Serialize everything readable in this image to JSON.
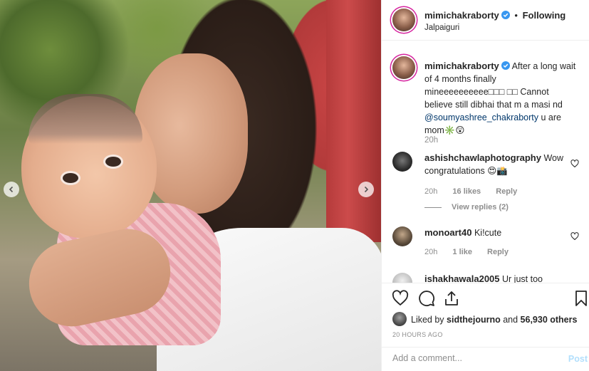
{
  "photo": {
    "alt_subject": "woman kissing baby"
  },
  "header": {
    "username": "mimichakraborty",
    "separator": "•",
    "follow_label": "Following",
    "location": "Jalpaiguri"
  },
  "caption": {
    "username": "mimichakraborty",
    "text_before": "After a long wait of 4 months finally mineeeeeeeeee□□□ □□ Cannot believe still dibhai that m a masi nd ",
    "mention": "@soumyashree_chakraborty",
    "text_after": " u are mom✳️😲",
    "time": "20h"
  },
  "comments": [
    {
      "username": "ashishchawlaphotography",
      "text": "Wow congratulations 😍📸",
      "time": "20h",
      "likes": "16 likes",
      "reply": "Reply",
      "view_replies": "View replies (2)"
    },
    {
      "username": "monoart40",
      "text": "Ki!cute",
      "time": "20h",
      "likes": "1 like",
      "reply": "Reply"
    },
    {
      "username": "ishakhawala2005",
      "text": "Ur just too"
    }
  ],
  "likes_line": {
    "prefix": "Liked by ",
    "liker": "sidthejourno",
    "middle": " and ",
    "others": "56,930 others"
  },
  "timestamp": "20 HOURS AGO",
  "add_comment": {
    "placeholder": "Add a comment...",
    "post_label": "Post"
  },
  "colors": {
    "link": "#00376b",
    "muted": "#8e8e8e",
    "post_disabled": "#b2dffc",
    "verified": "#3897f0"
  },
  "icons": [
    "chevron-left-icon",
    "chevron-right-icon",
    "verified-badge-icon",
    "heart-icon",
    "comment-icon",
    "share-icon",
    "bookmark-icon"
  ]
}
